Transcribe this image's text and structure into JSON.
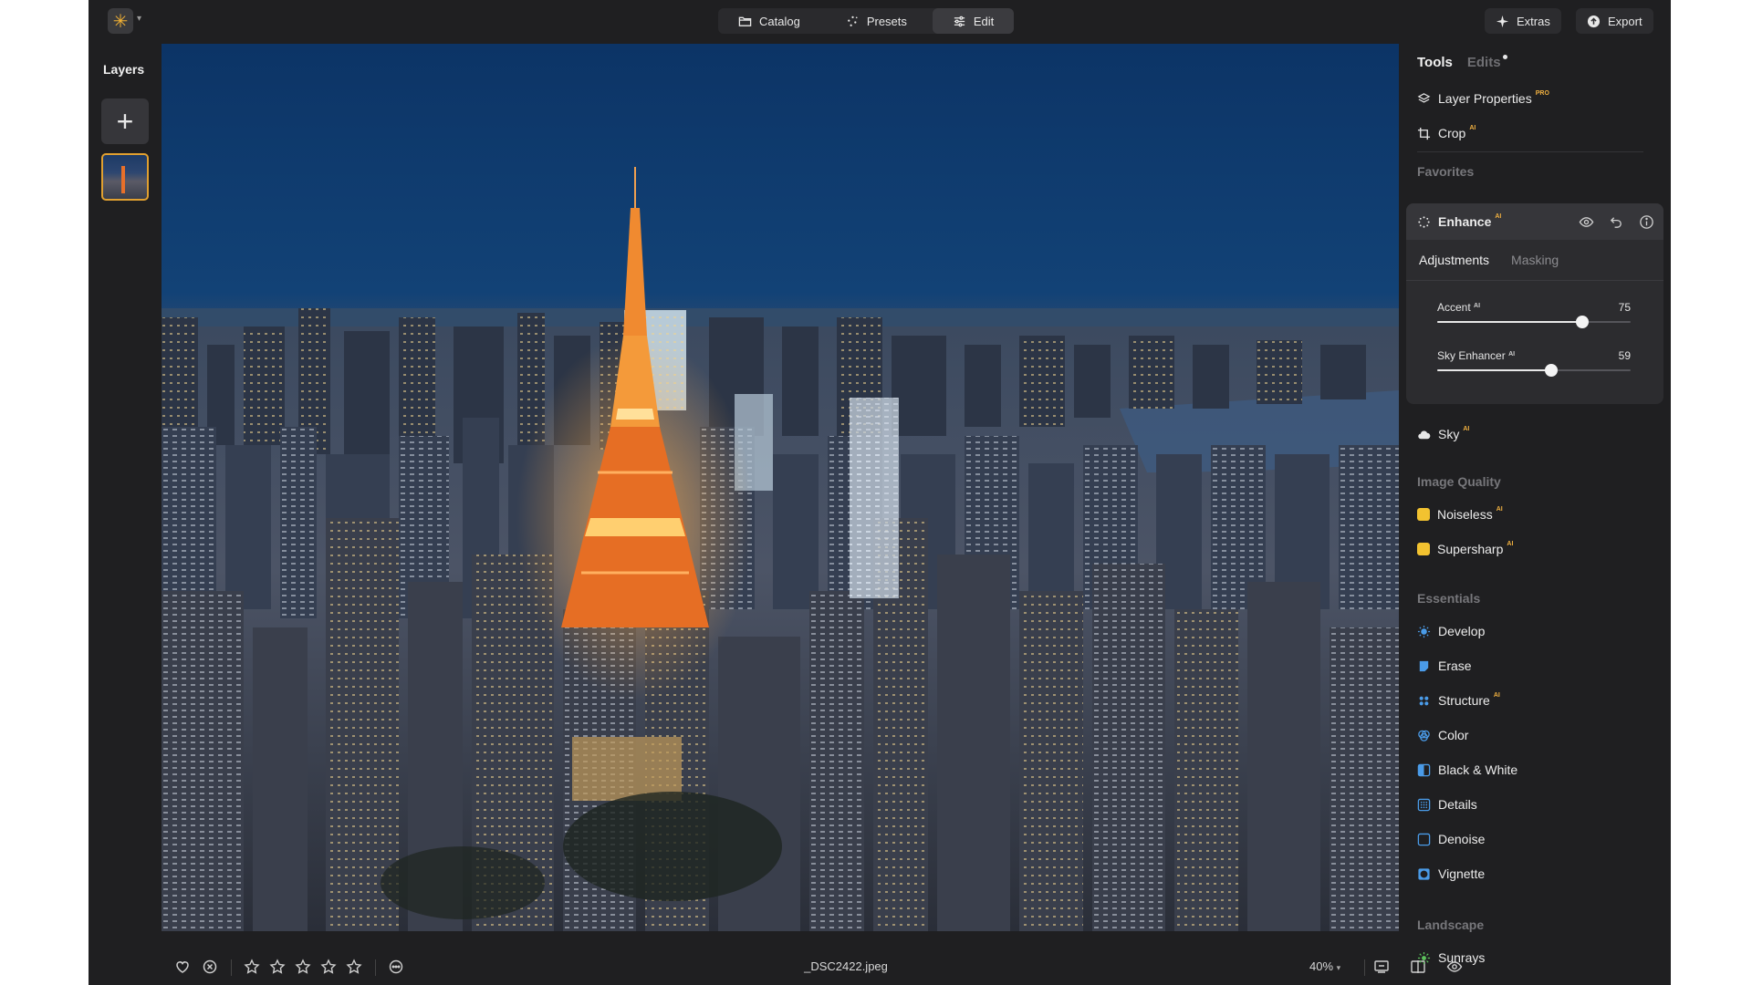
{
  "topbar": {
    "tabs": [
      {
        "label": "Catalog",
        "icon": "folder-icon"
      },
      {
        "label": "Presets",
        "icon": "sparkle-icon"
      },
      {
        "label": "Edit",
        "icon": "sliders-icon",
        "active": true
      }
    ],
    "extras_label": "Extras",
    "export_label": "Export"
  },
  "layers": {
    "title": "Layers",
    "add_label": "+"
  },
  "photo": {
    "description_icon": "cityscape-photo"
  },
  "bottombar": {
    "filename": "_DSC2422.jpeg",
    "zoom": "40%"
  },
  "panel": {
    "tabs": [
      "Tools",
      "Edits"
    ],
    "top_tools": [
      {
        "label": "Layer Properties",
        "badge": "PRO"
      },
      {
        "label": "Crop",
        "badge": "AI"
      }
    ],
    "favorites": "Favorites",
    "enhance": {
      "title": "Enhance",
      "badge": "AI",
      "subtabs": [
        "Adjustments",
        "Masking"
      ],
      "sliders": [
        {
          "label": "Accent",
          "badge": "AI",
          "value": "75",
          "fraction": 0.75
        },
        {
          "label": "Sky Enhancer",
          "badge": "AI",
          "value": "59",
          "fraction": 0.59
        }
      ]
    },
    "sky": {
      "label": "Sky",
      "badge": "AI"
    },
    "image_quality": {
      "title": "Image Quality",
      "items": [
        {
          "label": "Noiseless",
          "badge": "AI"
        },
        {
          "label": "Supersharp",
          "badge": "AI"
        }
      ]
    },
    "essentials": {
      "title": "Essentials",
      "items": [
        {
          "label": "Develop",
          "badge": ""
        },
        {
          "label": "Erase",
          "badge": ""
        },
        {
          "label": "Structure",
          "badge": "AI"
        },
        {
          "label": "Color",
          "badge": ""
        },
        {
          "label": "Black & White",
          "badge": ""
        },
        {
          "label": "Details",
          "badge": ""
        },
        {
          "label": "Denoise",
          "badge": ""
        },
        {
          "label": "Vignette",
          "badge": ""
        }
      ]
    },
    "landscape": {
      "title": "Landscape",
      "items": [
        {
          "label": "Sunrays",
          "badge": ""
        }
      ]
    }
  },
  "colors": {
    "accent": "#f0b040",
    "panel_bg": "#1f1f21",
    "card_bg": "#2c2c2f"
  }
}
